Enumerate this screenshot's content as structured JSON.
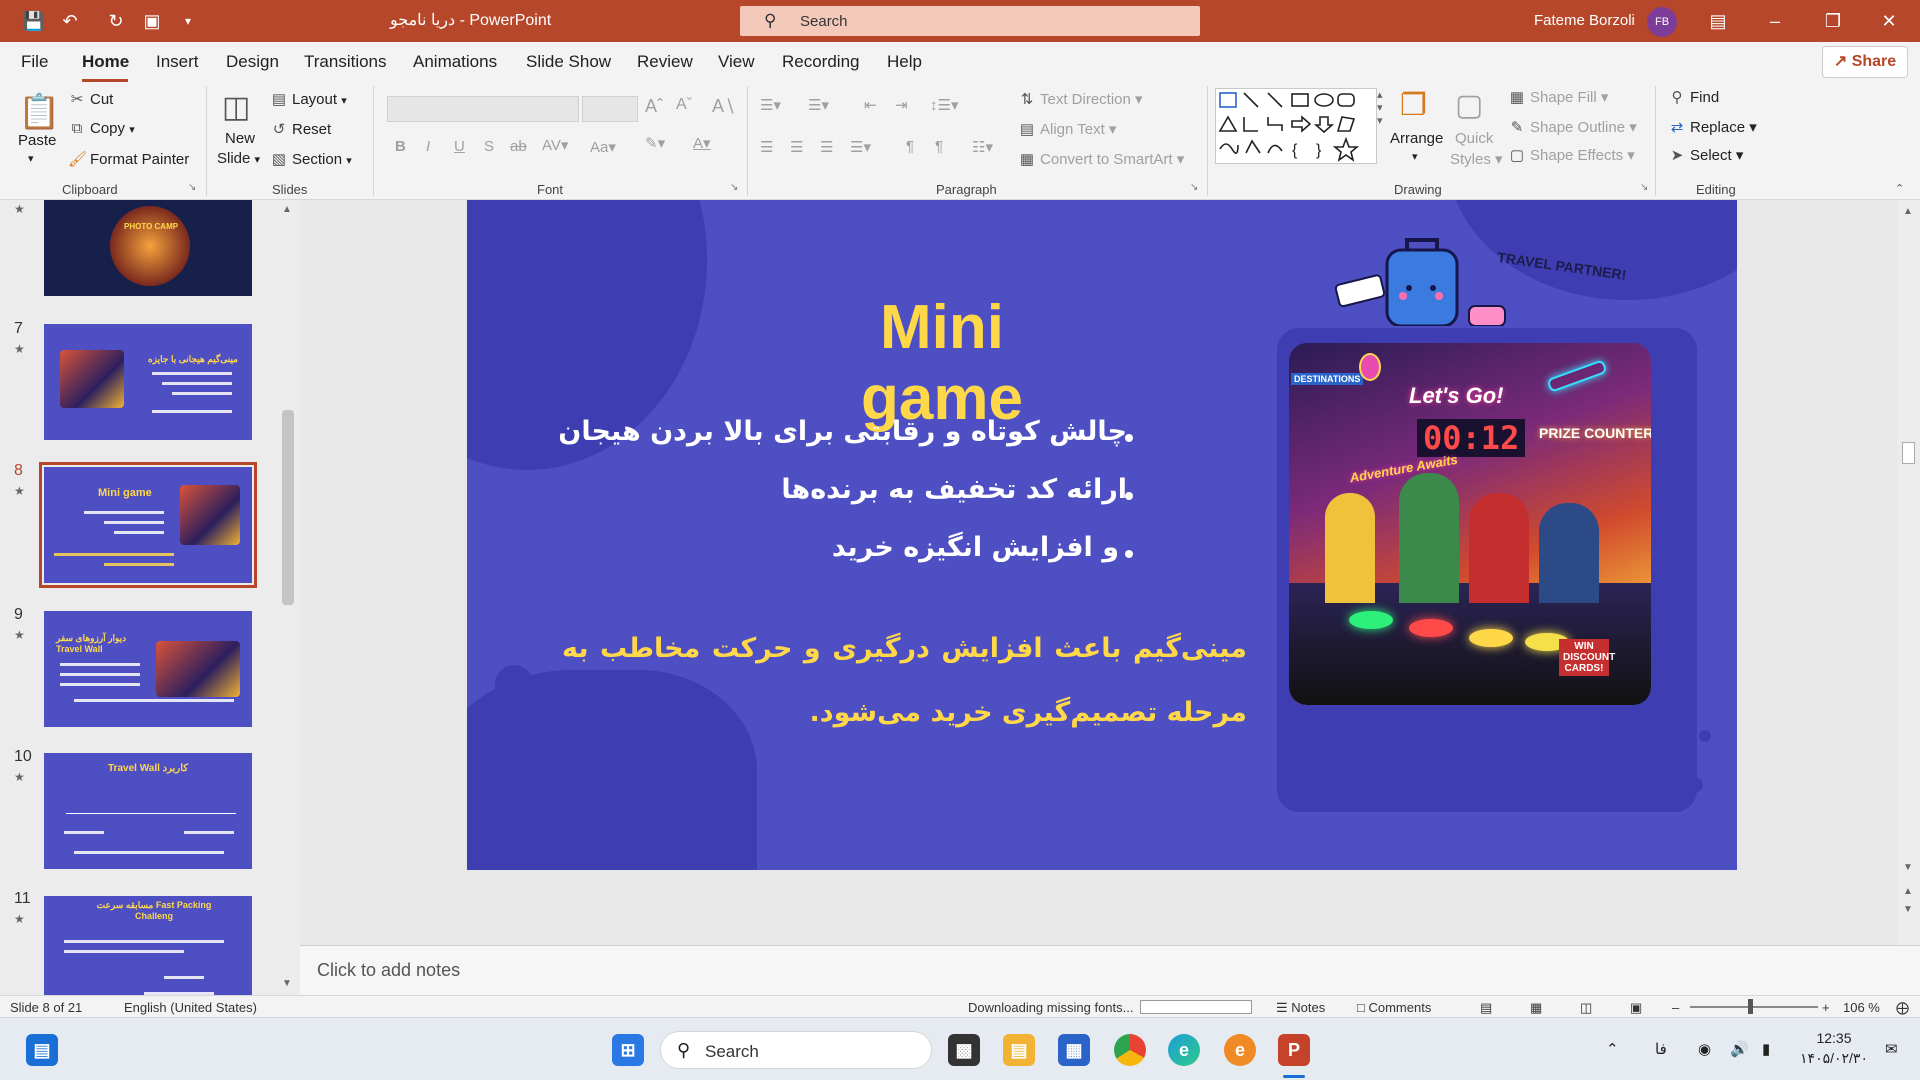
{
  "titlebar": {
    "doc_title": "دریا نامجو",
    "separator": "-",
    "app_name": "PowerPoint",
    "search_placeholder": "Search",
    "user_name": "Fateme Borzoli",
    "user_initials": "FB"
  },
  "menu": {
    "tabs": [
      "File",
      "Home",
      "Insert",
      "Design",
      "Transitions",
      "Animations",
      "Slide Show",
      "Review",
      "View",
      "Recording",
      "Help"
    ],
    "active_tab": "Home",
    "share_label": "Share"
  },
  "ribbon": {
    "clipboard": {
      "paste": "Paste",
      "cut": "Cut",
      "copy": "Copy",
      "format_painter": "Format Painter",
      "group": "Clipboard"
    },
    "slides": {
      "new_slide_1": "New",
      "new_slide_2": "Slide",
      "layout": "Layout",
      "reset": "Reset",
      "section": "Section",
      "group": "Slides"
    },
    "font": {
      "group": "Font",
      "change_case": "Aa"
    },
    "paragraph": {
      "text_direction": "Text Direction",
      "align_text": "Align Text",
      "convert_smartart": "Convert to SmartArt",
      "group": "Paragraph"
    },
    "drawing": {
      "arrange": "Arrange",
      "quick_styles_1": "Quick",
      "quick_styles_2": "Styles",
      "shape_fill": "Shape Fill",
      "shape_outline": "Shape Outline",
      "shape_effects": "Shape Effects",
      "group": "Drawing"
    },
    "editing": {
      "find": "Find",
      "replace": "Replace",
      "select": "Select",
      "group": "Editing"
    }
  },
  "thumbnails": [
    {
      "number": "7",
      "title": "مینی‌گیم هیجانی با جایزه"
    },
    {
      "number": "8",
      "title": "Mini game",
      "active": true
    },
    {
      "number": "9",
      "title": "دیوار آرزوهای سفر Travel Wall"
    },
    {
      "number": "10",
      "title": "Travel Wall کاربرد"
    },
    {
      "number": "11",
      "title": "مسابقه سرعت Fast Packing Challeng"
    }
  ],
  "thumb6_title": "PHOTO CAMP",
  "slide": {
    "title": "Mini game",
    "bullets": [
      "چالش کوتاه و رقابتی برای بالا بردن هیجان",
      "ارائه کد تخفیف به برنده‌ها",
      "و افزایش انگیزه خرید"
    ],
    "summary": "مینی‌گیم باعث افزایش درگیری و حرکت مخاطب به مرحله تصمیم‌گیری خرید می‌شود.",
    "badge": "TRAVEL PARTNER!",
    "image_signs": {
      "lets_go": "Let's Go!",
      "timer": "00:12",
      "prize": "PRIZE COUNTER",
      "adventure": "Adventure Awaits",
      "win": "WIN DISCOUNT CARDS!",
      "destinations": "DESTINATIONS"
    }
  },
  "notes_placeholder": "Click to add notes",
  "statusbar": {
    "slide_info": "Slide 8 of 21",
    "language": "English (United States)",
    "download": "Downloading missing fonts...",
    "notes": "Notes",
    "comments": "Comments",
    "zoom": "106 %"
  },
  "taskbar": {
    "search": "Search",
    "lang": "فا",
    "time": "12:35",
    "date": "۱۴۰۵/۰۲/۳۰"
  },
  "colors": {
    "accent": "#b7472a",
    "slide_bg": "#4f4fc4",
    "slide_title": "#ffd84a"
  }
}
